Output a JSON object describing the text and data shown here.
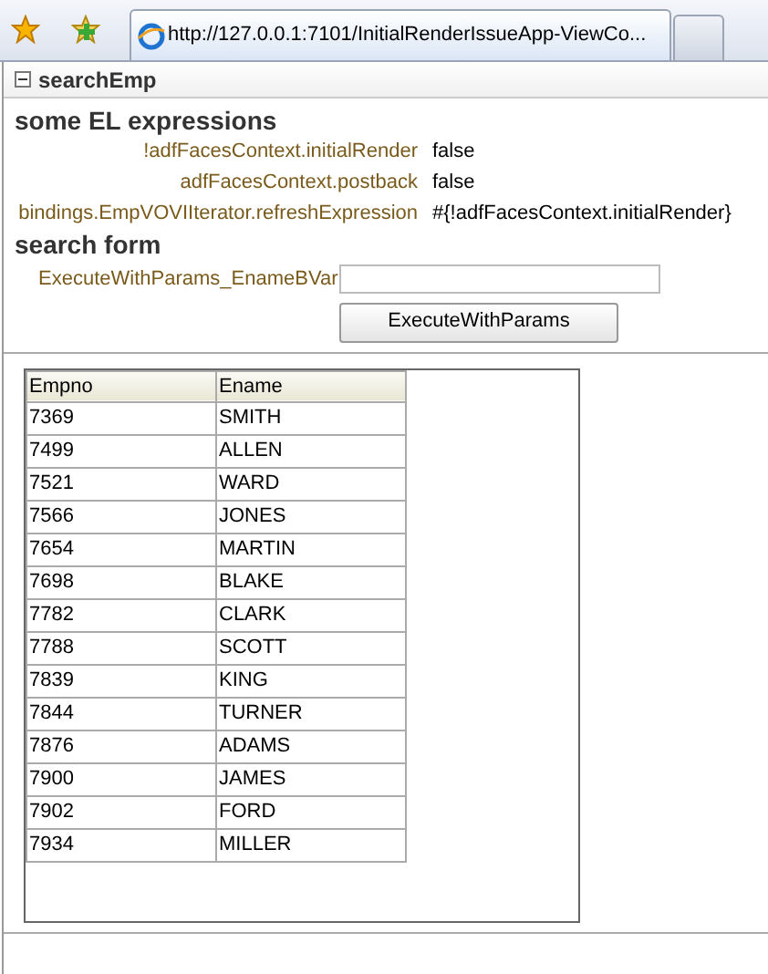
{
  "browser_tab": {
    "title": "http://127.0.0.1:7101/InitialRenderIssueApp-ViewCo..."
  },
  "panel": {
    "title": "searchEmp",
    "expanded": true
  },
  "el_section": {
    "heading": "some EL expressions",
    "rows": [
      {
        "label": "!adfFacesContext.initialRender",
        "value": "false"
      },
      {
        "label": "adfFacesContext.postback",
        "value": "false"
      },
      {
        "label": "bindings.EmpVOVIIterator.refreshExpression",
        "value": "#{!adfFacesContext.initialRender}"
      }
    ]
  },
  "search_form": {
    "heading": "search form",
    "field_label": "ExecuteWithParams_EnameBVar",
    "button": "ExecuteWithParams"
  },
  "table": {
    "columns": [
      "Empno",
      "Ename"
    ],
    "rows": [
      [
        "7369",
        "SMITH"
      ],
      [
        "7499",
        "ALLEN"
      ],
      [
        "7521",
        "WARD"
      ],
      [
        "7566",
        "JONES"
      ],
      [
        "7654",
        "MARTIN"
      ],
      [
        "7698",
        "BLAKE"
      ],
      [
        "7782",
        "CLARK"
      ],
      [
        "7788",
        "SCOTT"
      ],
      [
        "7839",
        "KING"
      ],
      [
        "7844",
        "TURNER"
      ],
      [
        "7876",
        "ADAMS"
      ],
      [
        "7900",
        "JAMES"
      ],
      [
        "7902",
        "FORD"
      ],
      [
        "7934",
        "MILLER"
      ]
    ]
  }
}
